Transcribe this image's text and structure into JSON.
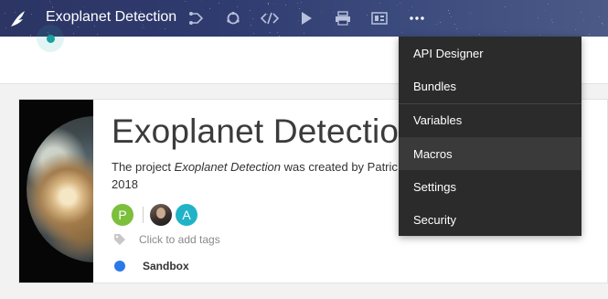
{
  "header": {
    "project_title": "Exoplanet Detection",
    "nav_icons": [
      "flow-icon",
      "recycle-icon",
      "code-icon",
      "play-icon",
      "print-icon",
      "dashboard-icon",
      "more-icon"
    ]
  },
  "menu": {
    "items": [
      {
        "label": "API Designer"
      },
      {
        "label": "Bundles"
      },
      {
        "label": "Variables"
      },
      {
        "label": "Macros"
      },
      {
        "label": "Settings"
      },
      {
        "label": "Security"
      }
    ]
  },
  "project": {
    "title": "Exoplanet Detection",
    "desc_prefix": "The project ",
    "desc_name": "Exoplanet Detection",
    "desc_suffix": " was created by Patric",
    "desc_line2": "2018",
    "avatars": {
      "p": "P",
      "a": "A"
    },
    "tags_label": "Click to add tags",
    "sandbox_label": "Sandbox"
  },
  "colors": {
    "status_dot": "#1aa0a0",
    "sandbox_dot": "#2b79e8",
    "avatar_p": "#7bbf3a",
    "avatar_a": "#20b3c7",
    "menu_bg": "#2b2b2b"
  }
}
